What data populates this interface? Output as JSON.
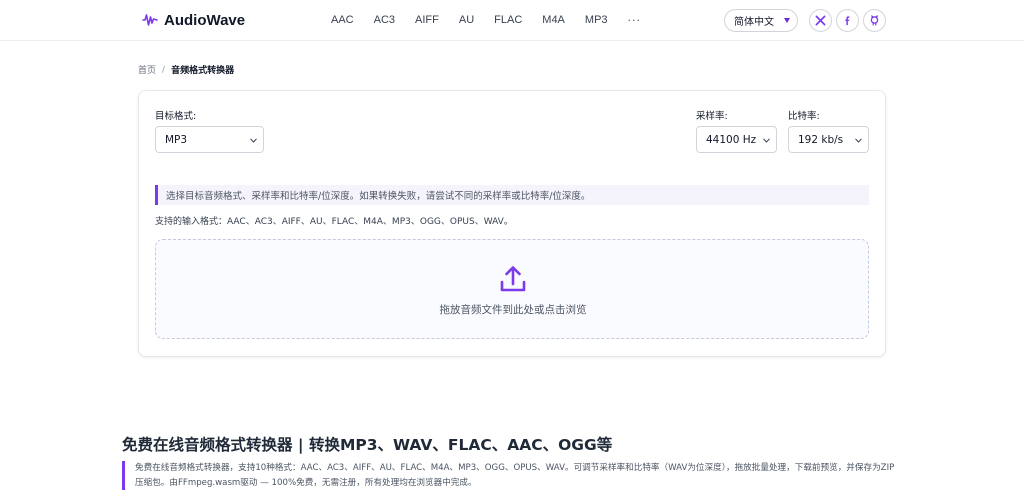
{
  "header": {
    "logo_text": "AudioWave",
    "nav": [
      "AAC",
      "AC3",
      "AIFF",
      "AU",
      "FLAC",
      "M4A",
      "MP3"
    ],
    "nav_more": "···",
    "language": "简体中文",
    "social_icons": [
      "x-icon",
      "facebook-icon",
      "github-icon"
    ]
  },
  "breadcrumb": {
    "home": "首页",
    "separator": "/",
    "current": "音频格式转换器"
  },
  "converter": {
    "target_format_label": "目标格式:",
    "target_format_value": "MP3",
    "sample_rate_label": "采样率:",
    "sample_rate_value": "44100 Hz",
    "bitrate_label": "比特率:",
    "bitrate_value": "192 kb/s",
    "note": "选择目标音频格式、采样率和比特率/位深度。如果转换失败，请尝试不同的采样率或比特率/位深度。",
    "supported_formats": "支持的输入格式：AAC、AC3、AIFF、AU、FLAC、M4A、MP3、OGG、OPUS、WAV。",
    "dropzone_text": "拖放音频文件到此处或点击浏览"
  },
  "content": {
    "heading": "免费在线音频格式转换器 | 转换MP3、WAV、FLAC、AAC、OGG等",
    "description": "免费在线音频格式转换器，支持10种格式：AAC、AC3、AIFF、AU、FLAC、M4A、MP3、OGG、OPUS、WAV。可调节采样率和比特率（WAV为位深度），拖放批量处理，下载前预览，并保存为ZIP压缩包。由FFmpeg.wasm驱动 — 100%免费，无需注册，所有处理均在浏览器中完成。"
  },
  "colors": {
    "accent": "#7c3aed",
    "border": "#e5e7eb",
    "text": "#1f2937"
  }
}
